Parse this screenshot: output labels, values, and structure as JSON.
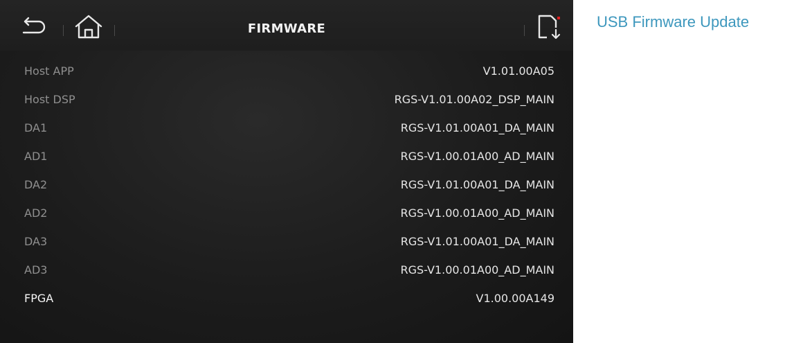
{
  "header": {
    "title": "FIRMWARE",
    "back_icon": "back-arrow-icon",
    "home_icon": "home-icon",
    "update_icon": "file-download-icon"
  },
  "firmware_rows": [
    {
      "label": "Host APP",
      "value": "V1.01.00A05"
    },
    {
      "label": "Host DSP",
      "value": "RGS-V1.01.00A02_DSP_MAIN"
    },
    {
      "label": "DA1",
      "value": "RGS-V1.01.00A01_DA_MAIN"
    },
    {
      "label": "AD1",
      "value": "RGS-V1.00.01A00_AD_MAIN"
    },
    {
      "label": "DA2",
      "value": "RGS-V1.01.00A01_DA_MAIN"
    },
    {
      "label": "AD2",
      "value": "RGS-V1.00.01A00_AD_MAIN"
    },
    {
      "label": "DA3",
      "value": "RGS-V1.01.00A01_DA_MAIN"
    },
    {
      "label": "AD3",
      "value": "RGS-V1.00.01A00_AD_MAIN"
    },
    {
      "label": "FPGA",
      "value": "V1.00.00A149"
    }
  ],
  "side_panel": {
    "title": "USB Firmware Update"
  },
  "colors": {
    "accent": "#3d97bd",
    "background": "#1c1c1c",
    "indicator": "#e02020"
  }
}
